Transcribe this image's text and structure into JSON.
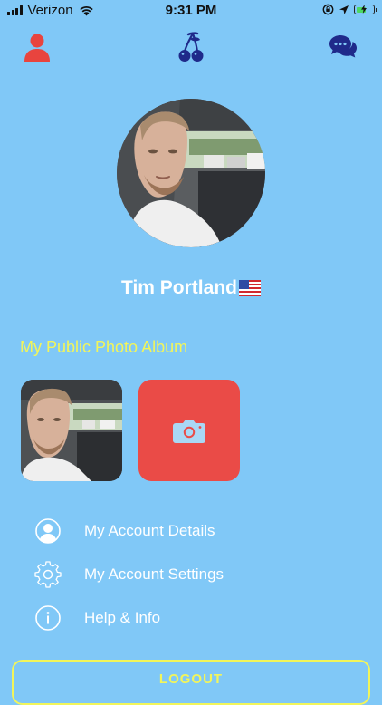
{
  "status_bar": {
    "carrier": "Verizon",
    "time": "9:31 PM",
    "battery_level": 0.6
  },
  "nav": {
    "profile_icon": "person-icon",
    "home_icon": "cherry-icon",
    "chat_icon": "chat-bubbles-icon"
  },
  "profile": {
    "name": "Tim Portland",
    "flag": "us-flag-icon"
  },
  "album": {
    "title": "My Public Photo Album",
    "add_icon": "camera-icon"
  },
  "menu": {
    "items": [
      {
        "label": "My Account Details",
        "icon": "user-circle-icon"
      },
      {
        "label": "My Account Settings",
        "icon": "gear-icon"
      },
      {
        "label": "Help & Info",
        "icon": "info-icon"
      }
    ]
  },
  "logout": {
    "label": "LOGOUT"
  },
  "colors": {
    "background": "#80c8f7",
    "accent_yellow": "#f2f55a",
    "accent_red": "#ea4b47",
    "nav_dark": "#1f2a8a"
  }
}
